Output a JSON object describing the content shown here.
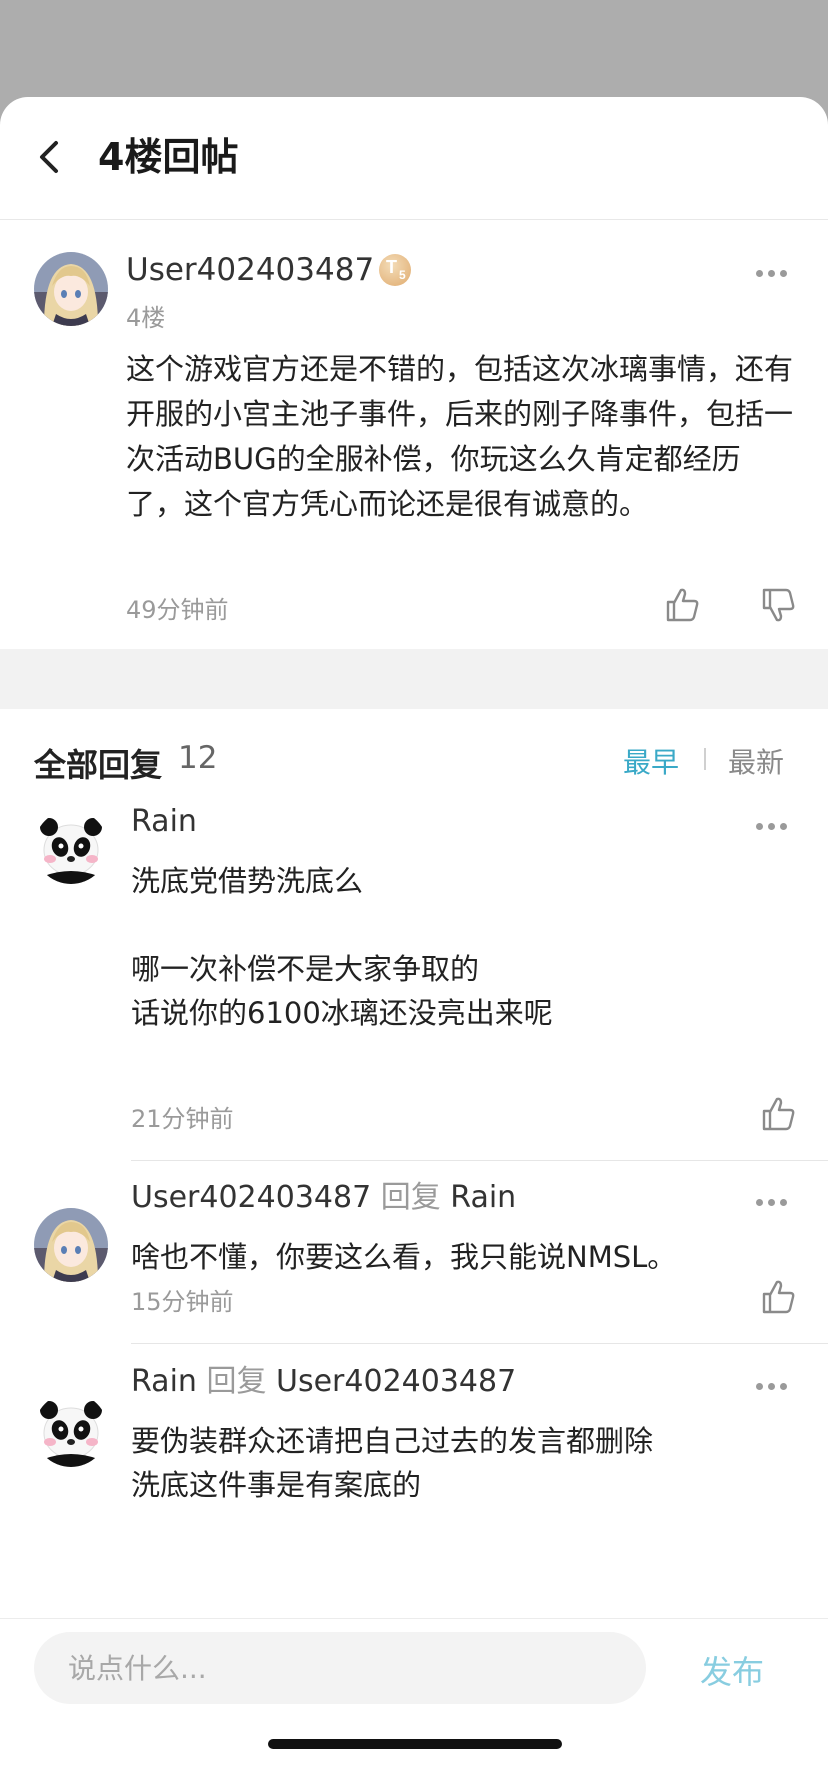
{
  "header": {
    "title": "4楼回帖"
  },
  "post": {
    "author": "User402403487",
    "level_badge": "T",
    "level_num": "5",
    "floor": "4楼",
    "body": "这个游戏官方还是不错的，包括这次冰璃事情，还有开服的小宫主池子事件，后来的刚子降事件，包括一次活动BUG的全服补偿，你玩这么久肯定都经历了，这个官方凭心而论还是很有诚意的。",
    "time": "49分钟前"
  },
  "replies_header": {
    "title": "全部回复",
    "count": "12",
    "sort_earliest": "最早",
    "sort_latest": "最新"
  },
  "replies": [
    {
      "author": "Rain",
      "reply_word": "",
      "reply_to": "",
      "body": "洗底党借势洗底么\n\n哪一次补偿不是大家争取的\n话说你的6100冰璃还没亮出来呢",
      "time": "21分钟前"
    },
    {
      "author": "User402403487",
      "reply_word": "回复",
      "reply_to": "Rain",
      "body": "啥也不懂，你要这么看，我只能说NMSL。",
      "time": "15分钟前"
    },
    {
      "author": "Rain",
      "reply_word": "回复",
      "reply_to": "User402403487",
      "body": "要伪装群众还请把自己过去的发言都删除\n洗底这件事是有案底的",
      "time": ""
    }
  ],
  "composer": {
    "placeholder": "说点什么...",
    "publish": "发布"
  },
  "colors": {
    "accent": "#3aa9c7",
    "publish": "#88cde0",
    "muted": "#9a9a9a",
    "band": "#f2f2f2"
  },
  "icons": [
    "back-arrow-icon",
    "level-badge-icon",
    "more-icon",
    "thumbs-up-icon",
    "thumbs-down-icon"
  ]
}
